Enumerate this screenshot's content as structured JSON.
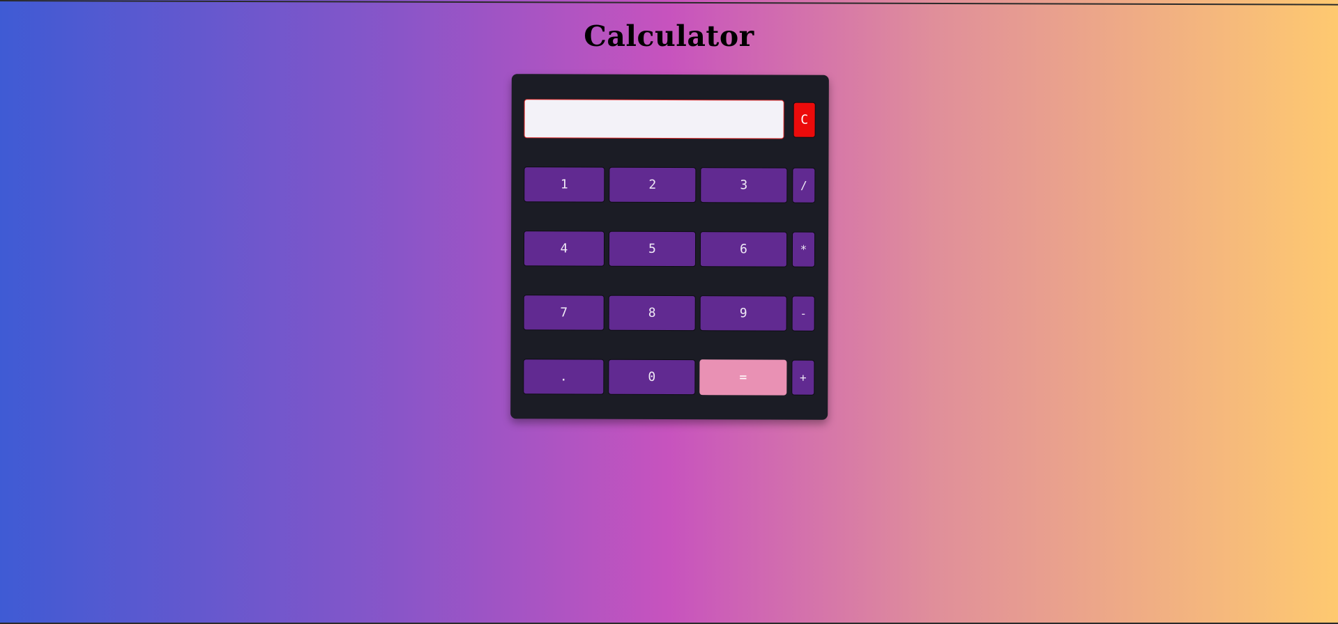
{
  "page": {
    "title": "Calculator"
  },
  "display": {
    "value": ""
  },
  "buttons": {
    "clear": "C",
    "row1": [
      "1",
      "2",
      "3",
      "/"
    ],
    "row2": [
      "4",
      "5",
      "6",
      "*"
    ],
    "row3": [
      "7",
      "8",
      "9",
      "-"
    ],
    "row4": [
      ".",
      "0",
      "=",
      "+"
    ]
  },
  "colors": {
    "background_gradient": [
      "#3f5bd4",
      "#c753be",
      "#fec970"
    ],
    "panel": "#1b1c25",
    "key": "#612a91",
    "clear_key": "#ec0b0b",
    "equals_key": "#e991b4",
    "display": "#f3f2f8"
  }
}
